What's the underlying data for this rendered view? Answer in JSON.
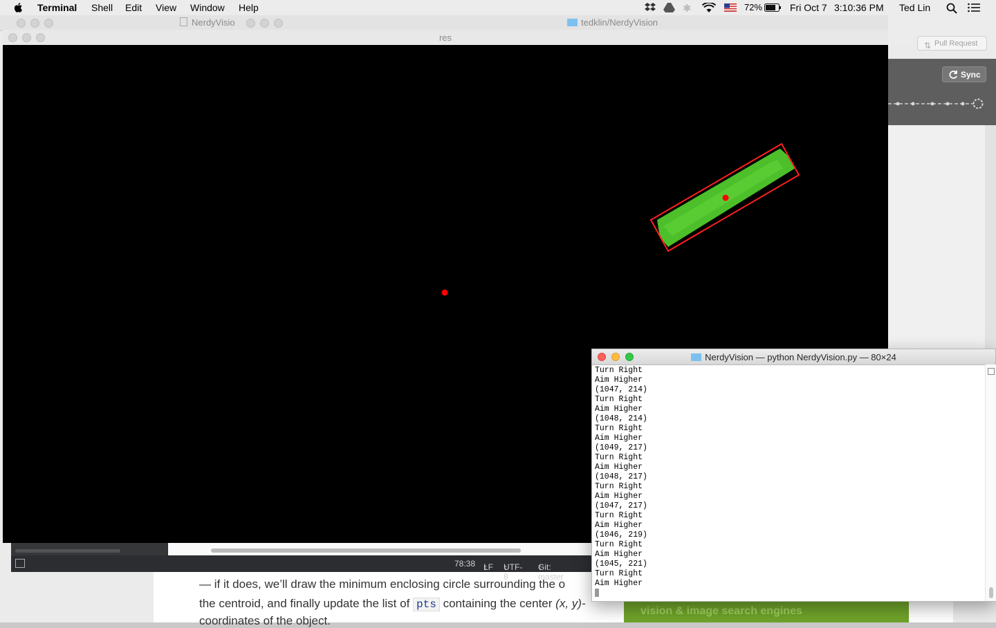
{
  "menubar": {
    "app": "Terminal",
    "items": [
      "Shell",
      "Edit",
      "View",
      "Window",
      "Help"
    ],
    "battery": "72%",
    "date": "Fri Oct 7",
    "time": "3:10:36 PM",
    "user": "Ted Lin"
  },
  "github": {
    "tab_left": "NerdyVisio",
    "tab_right": "tedklin/NerdyVision",
    "pull_request": "Pull Request",
    "sync": "Sync"
  },
  "res_window": {
    "title": "res"
  },
  "editor": {
    "cursor_pos": "78:38",
    "line_ending": "LF",
    "encoding": "UTF-8",
    "branch": "Git: master"
  },
  "webpage": {
    "line1": "— if it does, we’ll draw the minimum enclosing circle surrounding the o",
    "line2_pre": "the centroid, and finally update the list of",
    "code": "pts",
    "line2_post": "containing the center",
    "line2_xy": "(x, y)-",
    "line3": "coordinates of the object.",
    "ad": "vision & image search engines"
  },
  "terminal": {
    "title": "NerdyVision — python NerdyVision.py — 80×24",
    "lines": [
      "Turn Right",
      "Aim Higher",
      "(1047, 214)",
      "Turn Right",
      "Aim Higher",
      "(1048, 214)",
      "Turn Right",
      "Aim Higher",
      "(1049, 217)",
      "Turn Right",
      "Aim Higher",
      "(1048, 217)",
      "Turn Right",
      "Aim Higher",
      "(1047, 217)",
      "Turn Right",
      "Aim Higher",
      "(1046, 219)",
      "Turn Right",
      "Aim Higher",
      "(1045, 221)",
      "Turn Right",
      "Aim Higher"
    ]
  },
  "colors": {
    "target_green": "#4cbf2a",
    "marker_red": "#ff0000"
  }
}
